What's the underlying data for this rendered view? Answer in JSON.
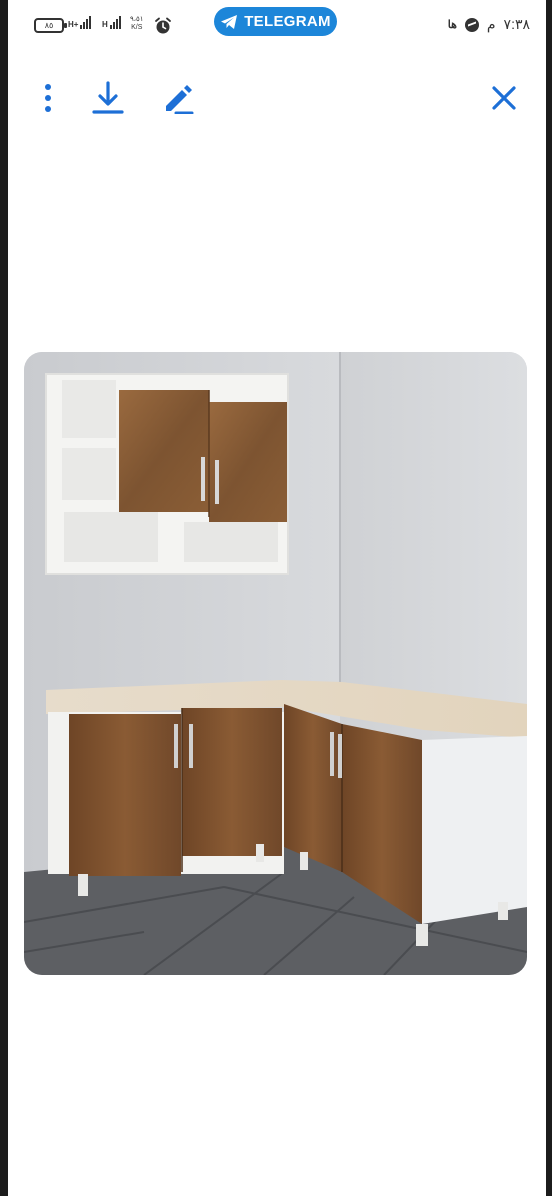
{
  "status_bar": {
    "battery_text": "٨٥",
    "signal1_label": "H+",
    "signal2_label": "H",
    "speed_value": "٩،٥١",
    "speed_unit": "K/S",
    "time": "٧:٣٨",
    "ampm": "م",
    "telegram_label": "TELEGRAM"
  },
  "toolbar": {
    "icons": [
      "more-vertical-icon",
      "download-icon",
      "edit-icon",
      "close-icon"
    ],
    "accent_color": "#1d6fd6"
  },
  "image": {
    "subject": "kitchen-cabinets-photo"
  }
}
